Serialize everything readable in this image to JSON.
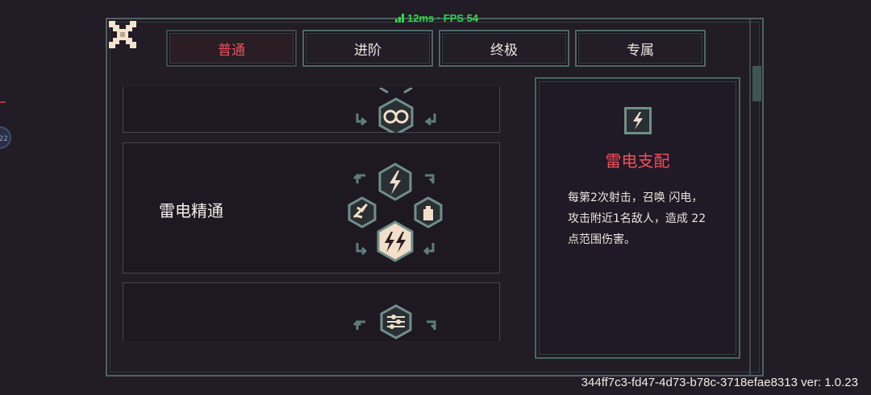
{
  "hud": {
    "fps_text": "12ms · FPS 54"
  },
  "side": {
    "badge": "22"
  },
  "tabs": [
    "普通",
    "进阶",
    "终极",
    "专属"
  ],
  "active_tab": 0,
  "cards": [
    {
      "name": ""
    },
    {
      "name": "雷电精通"
    },
    {
      "name": ""
    }
  ],
  "detail": {
    "title": "雷电支配",
    "description": "每第2次射击，召唤 闪电，攻击附近1名敌人，造成 22 点范围伤害。"
  },
  "footer": {
    "version": "344ff7c3-fd47-4d73-b78c-3718efae8313 ver: 1.0.23"
  },
  "colors": {
    "accent": "#ef4f5d",
    "frame": "#4a6462",
    "fps": "#35d24a",
    "background": "#221c26"
  },
  "icons": [
    "close-icon",
    "signal-icon",
    "lightning-icon",
    "eye-icon",
    "feather-icon",
    "potion-icon",
    "arrows-icon"
  ]
}
